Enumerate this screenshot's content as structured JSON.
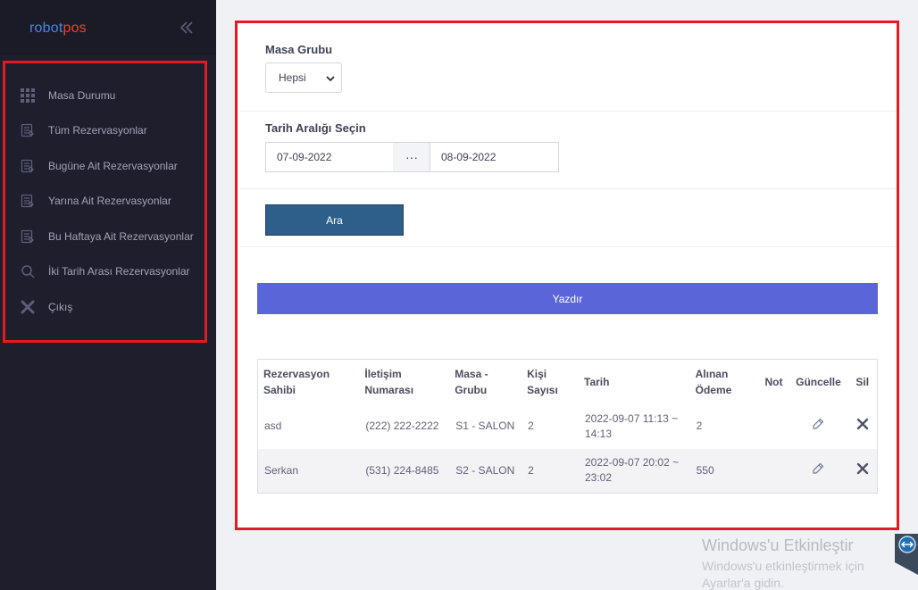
{
  "app": {
    "logo_part1": "robot",
    "logo_part2": "pos"
  },
  "sidebar": {
    "items": [
      {
        "label": "Masa Durumu",
        "icon": "grid-icon"
      },
      {
        "label": "Tüm Rezervasyonlar",
        "icon": "reservation-list-icon"
      },
      {
        "label": "Bugüne Ait Rezervasyonlar",
        "icon": "reservation-list-icon"
      },
      {
        "label": "Yarına Ait Rezervasyonlar",
        "icon": "reservation-list-icon"
      },
      {
        "label": "Bu Haftaya Ait Rezervasyonlar",
        "icon": "reservation-list-icon"
      },
      {
        "label": "İki Tarih Arası Rezervasyonlar",
        "icon": "search-icon"
      },
      {
        "label": "Çıkış",
        "icon": "close-icon"
      }
    ]
  },
  "filters": {
    "group_label": "Masa Grubu",
    "group_value": "Hepsi",
    "date_label": "Tarih Aralığı Seçin",
    "date_from": "07-09-2022",
    "date_sep": "···",
    "date_to": "08-09-2022",
    "search_button": "Ara"
  },
  "print_button": "Yazdır",
  "table": {
    "headers": {
      "owner_1": "Rezervasyon",
      "owner_2": "Sahibi",
      "phone_1": "İletişim",
      "phone_2": "Numarası",
      "group_1": "Masa -",
      "group_2": "Grubu",
      "count_1": "Kişi",
      "count_2": "Sayısı",
      "date": "Tarih",
      "paid_1": "Alınan",
      "paid_2": "Ödeme",
      "note": "Not",
      "update": "Güncelle",
      "delete": "Sil"
    },
    "rows": [
      {
        "owner": "asd",
        "phone": "(222) 222-2222",
        "group": "S1 - SALON",
        "count": "2",
        "date_1": "2022-09-07 11:13 ~",
        "date_2": "14:13",
        "paid": "2",
        "note": ""
      },
      {
        "owner": "Serkan",
        "phone": "(531) 224-8485",
        "group": "S2 - SALON",
        "count": "2",
        "date_1": "2022-09-07 20:02 ~",
        "date_2": "23:02",
        "paid": "550",
        "note": ""
      }
    ]
  },
  "watermark": {
    "line1": "Windows'u Etkinleştir",
    "line2": "Windows'u etkinleştirmek için",
    "line3": "Ayarlar'a gidin."
  },
  "colors": {
    "sidebar_bg": "#1e1e2d",
    "highlight_border": "#e01b24",
    "search_button": "#2e5f8a",
    "print_button": "#5a66d8"
  }
}
